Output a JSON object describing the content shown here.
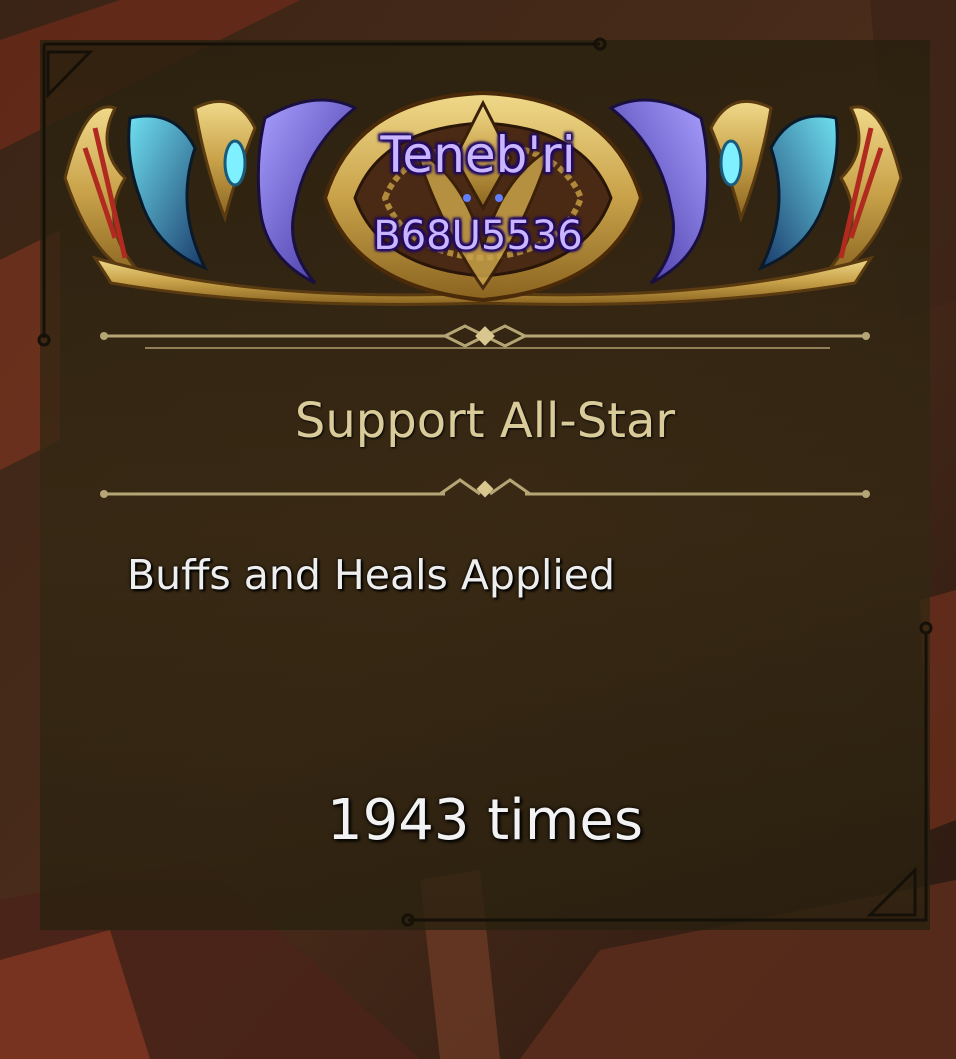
{
  "player": {
    "name": "Teneb'ri",
    "id": "B68U5536"
  },
  "award": {
    "title": "Support All-Star",
    "stat_label": "Buffs and Heals Applied",
    "stat_value": "1943 times"
  },
  "colors": {
    "gold": "#d9cc9a",
    "name_text": "#c9b6ff",
    "panel": "#2f2510"
  },
  "icons": [
    "guild-card-emblem",
    "ornament-divider"
  ]
}
